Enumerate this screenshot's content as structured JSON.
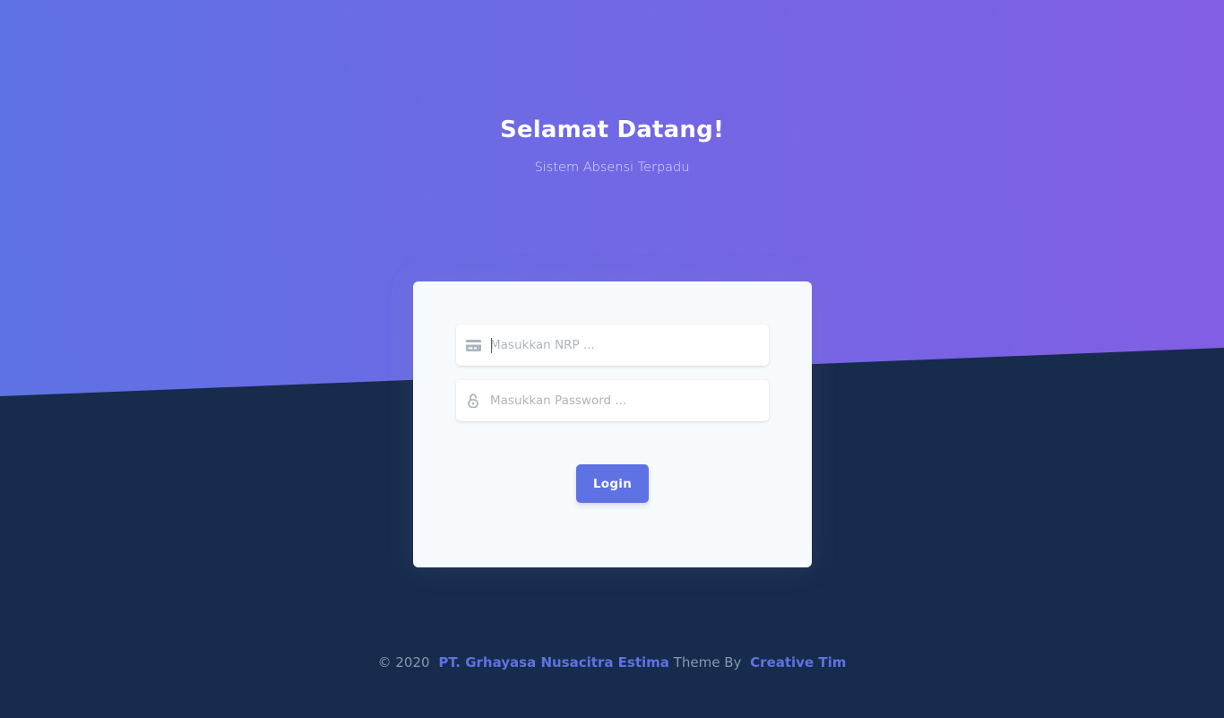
{
  "hero": {
    "title": "Selamat Datang!",
    "subtitle": "Sistem Absensi Terpadu"
  },
  "login_form": {
    "nrp": {
      "placeholder": "Masukkan NRP ...",
      "value": "",
      "icon": "credit-card-icon"
    },
    "password": {
      "placeholder": "Masukkan Password ...",
      "value": "",
      "icon": "unlock-icon"
    },
    "submit_label": "Login"
  },
  "footer": {
    "copyright": "© 2020",
    "company_link": "PT. Grhayasa Nusacitra Estima",
    "theme_text": "Theme By",
    "theme_link": "Creative Tim"
  },
  "colors": {
    "gradient_start": "#5e72e4",
    "gradient_end": "#825ee4",
    "background_dark": "#172b4d",
    "primary": "#5e72e4",
    "card_bg": "#f7fafc"
  }
}
